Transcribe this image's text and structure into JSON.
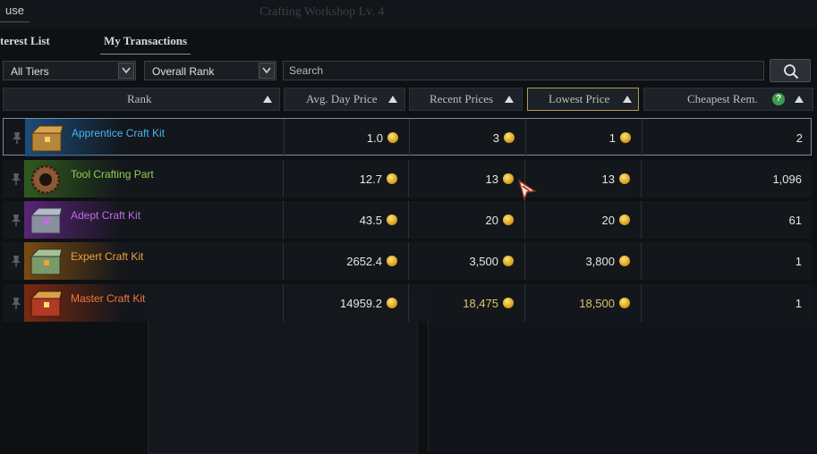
{
  "window": {
    "tab_label": "use",
    "background_title": "Crafting Workshop Lv. 4"
  },
  "tabs": [
    {
      "label": "terest List",
      "active": false
    },
    {
      "label": "My Transactions",
      "active": true
    }
  ],
  "filters": {
    "tier": "All Tiers",
    "rank": "Overall Rank",
    "search_placeholder": "Search"
  },
  "columns": {
    "rank": "Rank",
    "avg_day_price": "Avg. Day Price",
    "recent_prices": "Recent Prices",
    "lowest_price": "Lowest Price",
    "cheapest_rem": "Cheapest Rem.",
    "help": "?"
  },
  "items": [
    {
      "name": "Apprentice Craft Kit",
      "name_color": "#4ab3f0",
      "avg": "1.0",
      "recent": "3",
      "lowest": "1",
      "cheapest_rem": "2",
      "highlight_prices": false,
      "icon": "apprentice-kit-icon",
      "glow": "#1b4d7a"
    },
    {
      "name": "Tool Crafting Part",
      "name_color": "#8fd14f",
      "avg": "12.7",
      "recent": "13",
      "lowest": "13",
      "cheapest_rem": "1,096",
      "highlight_prices": false,
      "icon": "gear-part-icon",
      "glow": "#2f5a1e"
    },
    {
      "name": "Adept Craft Kit",
      "name_color": "#c46ae8",
      "avg": "43.5",
      "recent": "20",
      "lowest": "20",
      "cheapest_rem": "61",
      "highlight_prices": false,
      "icon": "adept-kit-icon",
      "glow": "#5a2478"
    },
    {
      "name": "Expert Craft Kit",
      "name_color": "#f0a040",
      "avg": "2652.4",
      "recent": "3,500",
      "lowest": "3,800",
      "cheapest_rem": "1",
      "highlight_prices": false,
      "icon": "expert-kit-icon",
      "glow": "#7a4a12"
    },
    {
      "name": "Master Craft Kit",
      "name_color": "#f07a3a",
      "avg": "14959.2",
      "recent": "18,475",
      "lowest": "18,500",
      "cheapest_rem": "1",
      "highlight_prices": true,
      "icon": "master-kit-icon",
      "glow": "#7a2a12"
    }
  ]
}
